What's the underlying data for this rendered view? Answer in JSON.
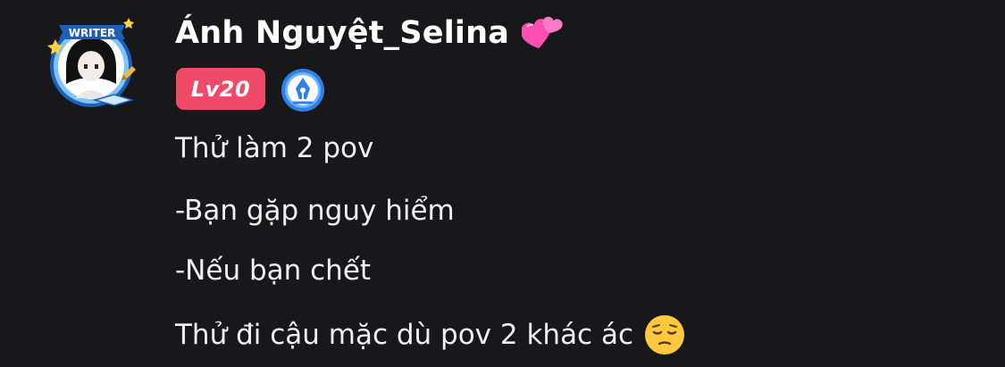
{
  "post": {
    "username": "Ánh Nguyệt_Selina",
    "level_badge": "Lv20",
    "avatar_frame_text": "WRITER",
    "icons": {
      "avatar": "writer-avatar-icon",
      "name_emoji": "two-hearts-icon",
      "badge": "pen-nib-badge-icon",
      "message_emoji": "pensive-face-icon"
    },
    "colors": {
      "background": "#18181a",
      "level_badge": "#ef4a67",
      "badge_blue": "#2f7fe6",
      "heart_pink": "#ff4fb0"
    },
    "lines": [
      "Thử làm 2 pov",
      "-Bạn gặp nguy hiểm",
      "-Nếu bạn chết",
      "Thử đi cậu mặc dù pov 2 khác ác"
    ]
  }
}
